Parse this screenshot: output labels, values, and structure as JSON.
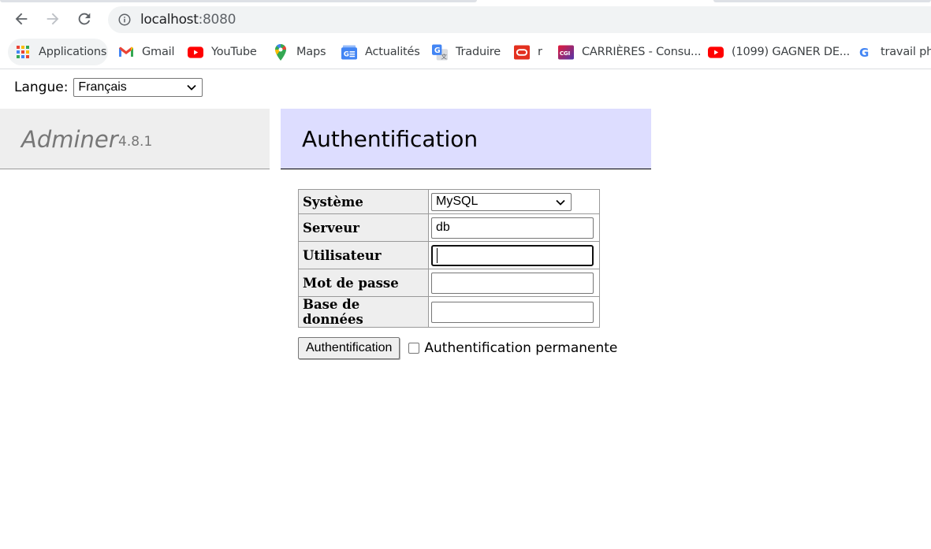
{
  "browser": {
    "url_host": "localhost",
    "url_port": ":8080",
    "bookmarks": [
      {
        "label": "Applications",
        "icon": "apps-grid-icon"
      },
      {
        "label": "Gmail",
        "icon": "gmail-icon"
      },
      {
        "label": "YouTube",
        "icon": "youtube-icon"
      },
      {
        "label": "Maps",
        "icon": "maps-pin-icon"
      },
      {
        "label": "Actualités",
        "icon": "google-news-icon"
      },
      {
        "label": "Traduire",
        "icon": "google-translate-icon"
      },
      {
        "label": "r",
        "icon": "oracle-icon"
      },
      {
        "label": "CARRIÈRES - Consu...",
        "icon": "cgi-icon",
        "icon_text": "CGI"
      },
      {
        "label": "(1099) GAGNER DE...",
        "icon": "youtube-icon"
      },
      {
        "label": "travail pho",
        "icon": "google-icon",
        "icon_text": "G"
      }
    ]
  },
  "page": {
    "language_label": "Langue:",
    "language_value": "Français",
    "brand_name": "Adminer",
    "brand_version": "4.8.1",
    "title": "Authentification",
    "form": {
      "system_label": "Système",
      "system_value": "MySQL",
      "server_label": "Serveur",
      "server_value": "db",
      "user_label": "Utilisateur",
      "user_value": "",
      "password_label": "Mot de passe",
      "password_value": "",
      "database_label": "Base de données",
      "database_value": ""
    },
    "submit_label": "Authentification",
    "permanent_label": "Authentification permanente",
    "permanent_checked": false
  },
  "colors": {
    "heading_bg": "#ddddff",
    "brand_bg": "#eeeeee",
    "youtube_red": "#ff0000",
    "oracle_red": "#e3301f"
  }
}
